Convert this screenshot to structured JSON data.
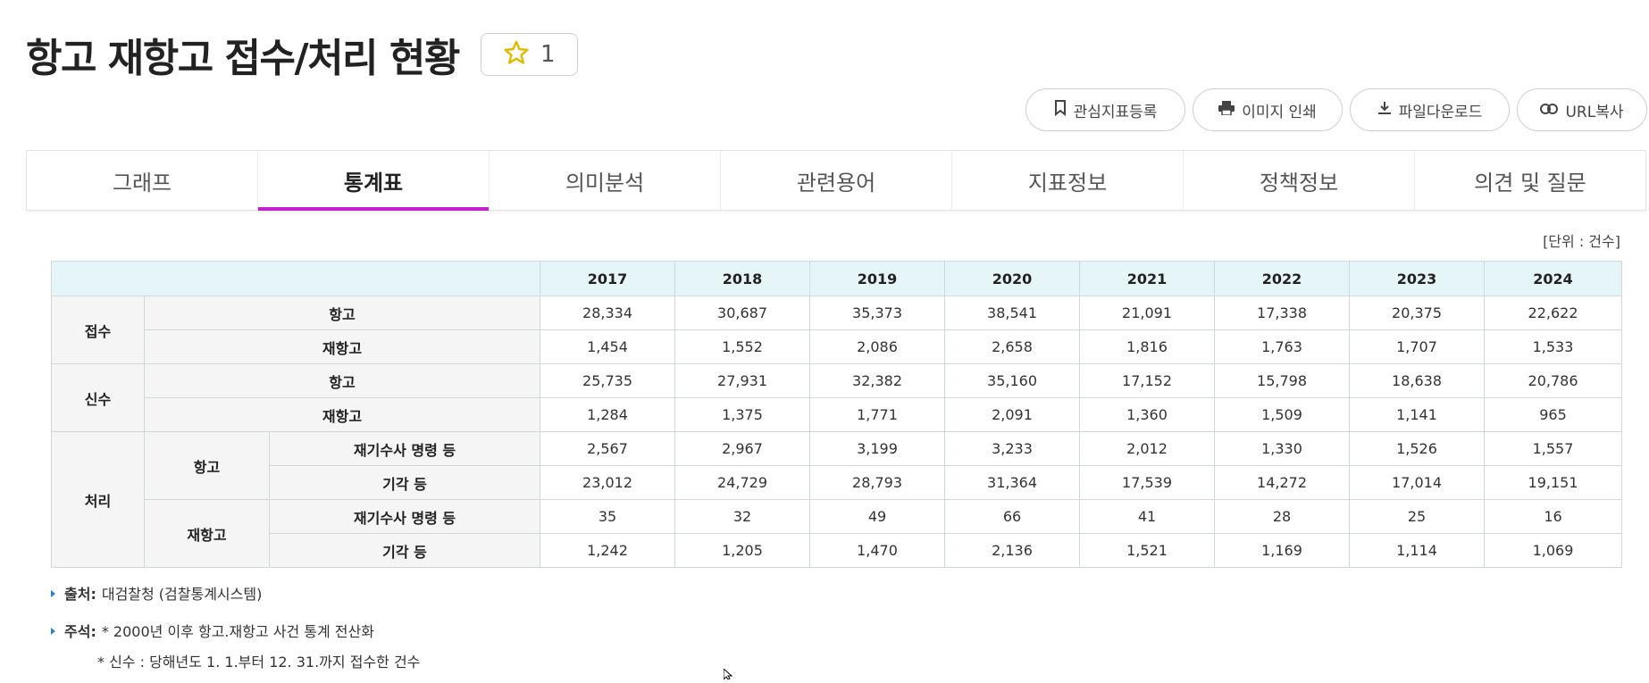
{
  "page": {
    "title": "항고 재항고 접수/처리 현황",
    "favorite_count": "1",
    "favorite_icon": "star-icon",
    "accent_color": "#c71ed1",
    "header_bg": "#e6f6f8"
  },
  "actions": [
    {
      "label": "관심지표등록",
      "icon": "bookmark-icon"
    },
    {
      "label": "이미지 인쇄",
      "icon": "printer-icon"
    },
    {
      "label": "파일다운로드",
      "icon": "download-icon"
    },
    {
      "label": "URL복사",
      "icon": "link-icon"
    }
  ],
  "tabs": [
    {
      "label": "그래프",
      "active": false
    },
    {
      "label": "통계표",
      "active": true
    },
    {
      "label": "의미분석",
      "active": false
    },
    {
      "label": "관련용어",
      "active": false
    },
    {
      "label": "지표정보",
      "active": false
    },
    {
      "label": "정책정보",
      "active": false
    },
    {
      "label": "의견 및 질문",
      "active": false
    }
  ],
  "unit": "[단위 : 건수]",
  "table": {
    "years": [
      "2017",
      "2018",
      "2019",
      "2020",
      "2021",
      "2022",
      "2023",
      "2024"
    ],
    "groups": {
      "receipt": "접수",
      "new": "신수",
      "process": "처리",
      "appeal": "항고",
      "reappeal": "재항고",
      "reinvestigate": "재기수사 명령 등",
      "dismiss": "기각 등"
    },
    "rows": {
      "receipt_appeal": [
        "28,334",
        "30,687",
        "35,373",
        "38,541",
        "21,091",
        "17,338",
        "20,375",
        "22,622"
      ],
      "receipt_reappeal": [
        "1,454",
        "1,552",
        "2,086",
        "2,658",
        "1,816",
        "1,763",
        "1,707",
        "1,533"
      ],
      "new_appeal": [
        "25,735",
        "27,931",
        "32,382",
        "35,160",
        "17,152",
        "15,798",
        "18,638",
        "20,786"
      ],
      "new_reappeal": [
        "1,284",
        "1,375",
        "1,771",
        "2,091",
        "1,360",
        "1,509",
        "1,141",
        "965"
      ],
      "process_appeal_reinvestigate": [
        "2,567",
        "2,967",
        "3,199",
        "3,233",
        "2,012",
        "1,330",
        "1,526",
        "1,557"
      ],
      "process_appeal_dismiss": [
        "23,012",
        "24,729",
        "28,793",
        "31,364",
        "17,539",
        "14,272",
        "17,014",
        "19,151"
      ],
      "process_reappeal_reinvestigate": [
        "35",
        "32",
        "49",
        "66",
        "41",
        "28",
        "25",
        "16"
      ],
      "process_reappeal_dismiss": [
        "1,242",
        "1,205",
        "1,470",
        "2,136",
        "1,521",
        "1,169",
        "1,114",
        "1,069"
      ]
    }
  },
  "notes": {
    "source_label": "출처:",
    "source_text": "대검찰청 (검찰통계시스템)",
    "remark_label": "주석:",
    "remark_line1": "* 2000년 이후 항고.재항고 사건 통계 전산화",
    "remark_line2": "* 신수 : 당해년도 1. 1.부터 12. 31.까지 접수한 건수"
  }
}
